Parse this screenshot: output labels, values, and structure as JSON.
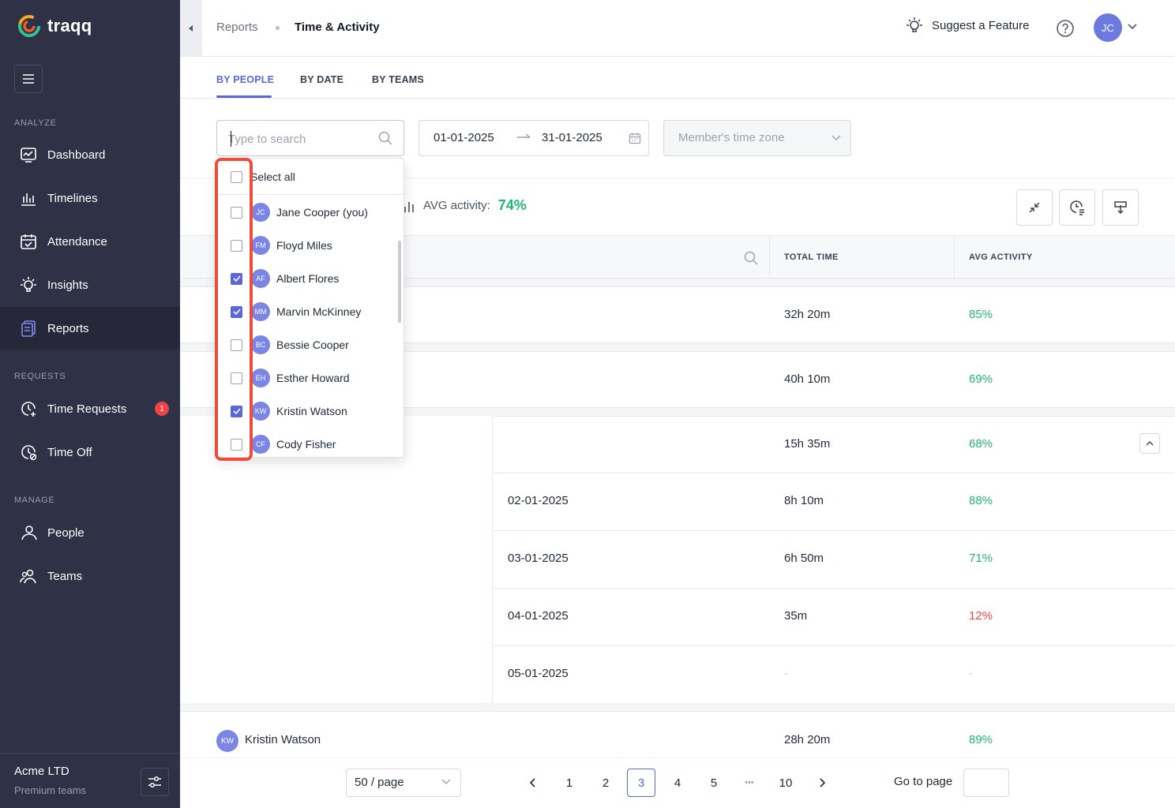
{
  "app": {
    "name": "traqq"
  },
  "sidebar": {
    "sections": [
      {
        "label": "ANALYZE"
      },
      {
        "label": "REQUESTS"
      },
      {
        "label": "MANAGE"
      }
    ],
    "items": [
      {
        "label": "Dashboard",
        "icon": "dashboard-icon"
      },
      {
        "label": "Timelines",
        "icon": "bar-chart-icon"
      },
      {
        "label": "Attendance",
        "icon": "calendar-check-icon"
      },
      {
        "label": "Insights",
        "icon": "lightbulb-icon"
      },
      {
        "label": "Reports",
        "icon": "report-icon",
        "active": true
      },
      {
        "label": "Time Requests",
        "icon": "clock-plus-icon",
        "badge": "1"
      },
      {
        "label": "Time Off",
        "icon": "clock-off-icon"
      },
      {
        "label": "People",
        "icon": "person-icon"
      },
      {
        "label": "Teams",
        "icon": "team-icon"
      }
    ],
    "footer": {
      "company": "Acme LTD",
      "plan": "Premium teams"
    }
  },
  "header": {
    "breadcrumb": [
      "Reports",
      "Time & Activity"
    ],
    "suggest_label": "Suggest a Feature",
    "user_initials": "JC"
  },
  "tabs": [
    "BY PEOPLE",
    "BY DATE",
    "BY TEAMS"
  ],
  "filters": {
    "search_placeholder": "Type to search",
    "date_from": "01-01-2025",
    "date_to": "31-01-2025",
    "timezone_placeholder": "Member's time zone"
  },
  "summary": {
    "avg_label": "AVG activity:",
    "avg_value": "74%"
  },
  "table": {
    "columns": [
      "TOTAL TIME",
      "AVG ACTIVITY"
    ],
    "rows": [
      {
        "total": "32h 20m",
        "activity": "85%"
      },
      {
        "total": "40h 10m",
        "activity": "69%"
      },
      {
        "total": "15h 35m",
        "activity": "68%"
      }
    ],
    "sub_rows": [
      {
        "date": "02-01-2025",
        "total": "8h 10m",
        "activity": "88%"
      },
      {
        "date": "03-01-2025",
        "total": "6h 50m",
        "activity": "71%"
      },
      {
        "date": "04-01-2025",
        "total": "35m",
        "activity": "12%"
      },
      {
        "date": "05-01-2025",
        "total": "-",
        "activity": "-"
      }
    ],
    "last_row": {
      "initials": "KW",
      "name": "Kristin Watson",
      "total": "28h 20m",
      "activity": "89%"
    }
  },
  "dropdown": {
    "select_all": "Select all",
    "members": [
      {
        "initials": "JC",
        "name": "Jane Cooper (you)",
        "checked": false
      },
      {
        "initials": "FM",
        "name": "Floyd Miles",
        "checked": false
      },
      {
        "initials": "AF",
        "name": "Albert Flores",
        "checked": true
      },
      {
        "initials": "MM",
        "name": "Marvin McKinney",
        "checked": true
      },
      {
        "initials": "BC",
        "name": "Bessie Cooper",
        "checked": false
      },
      {
        "initials": "EH",
        "name": "Esther Howard",
        "checked": false
      },
      {
        "initials": "KW",
        "name": "Kristin Watson",
        "checked": true
      },
      {
        "initials": "CF",
        "name": "Cody Fisher",
        "checked": false
      }
    ]
  },
  "pagination": {
    "page_size": "50 / page",
    "pages": [
      "1",
      "2",
      "3",
      "4",
      "5",
      "•••",
      "10"
    ],
    "current": "3",
    "goto_label": "Go to page"
  },
  "colors": {
    "accent": "#5a67d8",
    "sidebar": "#2f3147",
    "positive": "#22b573",
    "negative": "#ef4444",
    "highlight": "#ee4d3b"
  }
}
